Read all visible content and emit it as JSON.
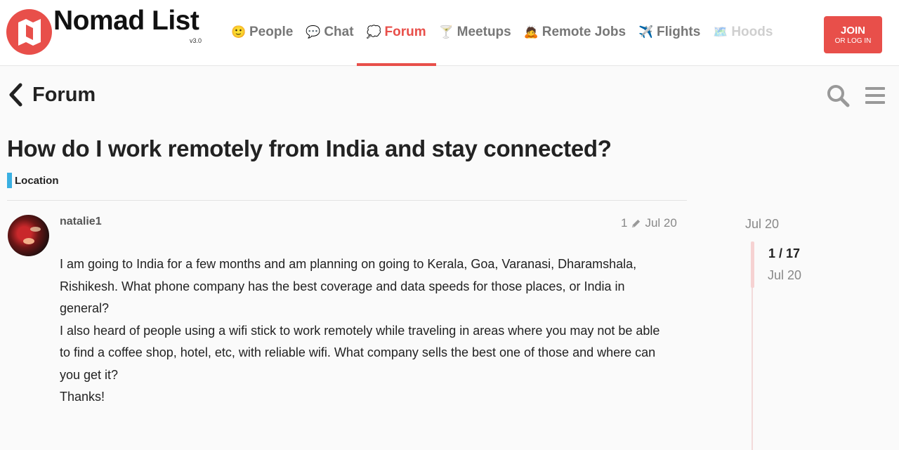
{
  "header": {
    "brand": "Nomad List",
    "version": "v3.0",
    "nav": [
      {
        "icon": "smile-emoji-icon",
        "glyph": "🙂",
        "label": "People"
      },
      {
        "icon": "speech-bubble-icon",
        "glyph": "💬",
        "label": "Chat"
      },
      {
        "icon": "thought-bubble-icon",
        "glyph": "💭",
        "label": "Forum"
      },
      {
        "icon": "cocktail-icon",
        "glyph": "🍸",
        "label": "Meetups"
      },
      {
        "icon": "person-laptop-icon",
        "glyph": "🙇",
        "label": "Remote Jobs"
      },
      {
        "icon": "airplane-icon",
        "glyph": "✈️",
        "label": "Flights"
      },
      {
        "icon": "map-icon",
        "glyph": "🗺️",
        "label": "Hoods"
      }
    ],
    "active_nav": "Forum",
    "join": {
      "main": "JOIN",
      "sub": "OR LOG IN"
    },
    "accent_color": "#e84f4a"
  },
  "forum": {
    "back_label": "Forum",
    "topic_title": "How do I work remotely from India and stay connected?",
    "category": {
      "label": "Location",
      "color": "#3ab0e2"
    }
  },
  "post": {
    "username": "natalie1",
    "edit_count": "1",
    "date": "Jul 20",
    "body": [
      "I am going to India for a few months and am planning on going to Kerala, Goa, Varanasi, Dharamshala, Rishikesh. What phone company has the best coverage and data speeds for those places, or India in general?",
      "I also heard of people using a wifi stick to work remotely while traveling in areas where you may not be able to find a coffee shop, hotel, etc, with reliable wifi. What company sells the best one of those and where can you get it?",
      "Thanks!"
    ]
  },
  "timeline": {
    "start_date": "Jul 20",
    "position": "1 / 17",
    "current_date": "Jul 20"
  }
}
